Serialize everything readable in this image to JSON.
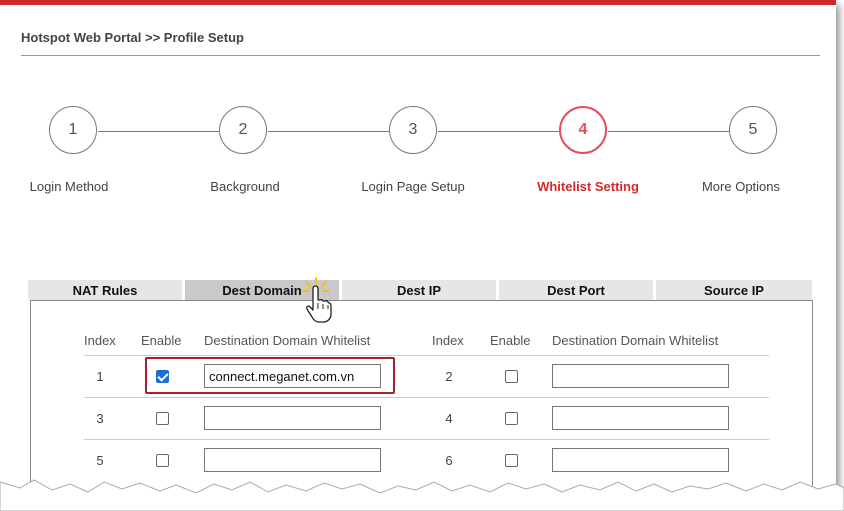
{
  "breadcrumb": "Hotspot Web Portal >> Profile Setup",
  "steps": [
    {
      "number": "1",
      "label": "Login Method"
    },
    {
      "number": "2",
      "label": "Background"
    },
    {
      "number": "3",
      "label": "Login Page Setup"
    },
    {
      "number": "4",
      "label": "Whitelist Setting"
    },
    {
      "number": "5",
      "label": "More Options"
    }
  ],
  "active_step": 4,
  "tabs": [
    "NAT Rules",
    "Dest Domain",
    "Dest IP",
    "Dest Port",
    "Source IP"
  ],
  "active_tab": "Dest Domain",
  "table": {
    "headers": {
      "index": "Index",
      "enable": "Enable",
      "domain": "Destination Domain Whitelist"
    },
    "rows": [
      {
        "left_index": "1",
        "left_enabled": true,
        "left_value": "connect.meganet.com.vn",
        "right_index": "2",
        "right_enabled": false,
        "right_value": ""
      },
      {
        "left_index": "3",
        "left_enabled": false,
        "left_value": "",
        "right_index": "4",
        "right_enabled": false,
        "right_value": ""
      },
      {
        "left_index": "5",
        "left_enabled": false,
        "left_value": "",
        "right_index": "6",
        "right_enabled": false,
        "right_value": ""
      }
    ]
  },
  "colors": {
    "accent": "#cc2a2a",
    "active_step": "#e0505c",
    "checkbox_checked": "#1a6fd8",
    "highlight_box": "#a8202a"
  },
  "icons": {
    "cursor": "hand-pointer-icon"
  }
}
